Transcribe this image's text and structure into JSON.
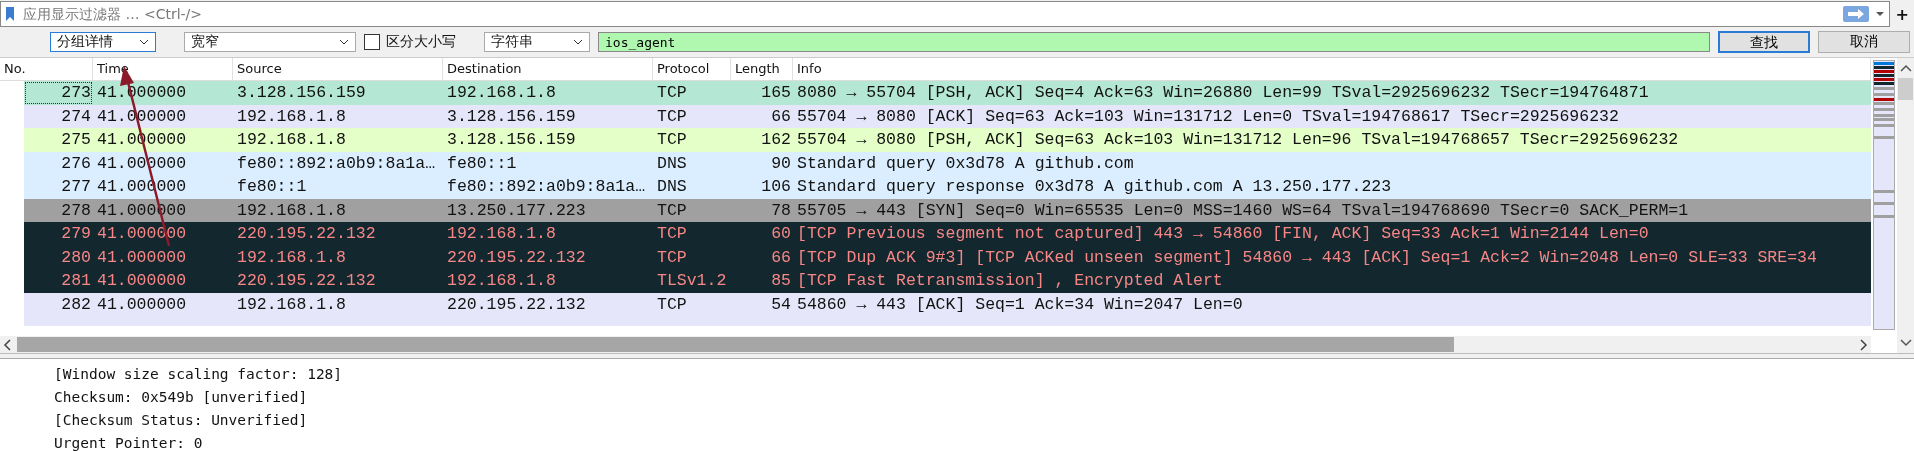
{
  "filter_bar": {
    "placeholder": "应用显示过滤器 … <Ctrl-/>",
    "add_label": "+"
  },
  "find_bar": {
    "search_in": "分组详情",
    "charset": "宽窄",
    "case_sensitive": {
      "label": "区分大小写",
      "checked": false
    },
    "search_type": "字符串",
    "value": "ios_agent",
    "buttons": [
      "查找",
      "取消"
    ]
  },
  "table": {
    "columns": [
      "No.",
      "Time",
      "Source",
      "Destination",
      "Protocol",
      "Length",
      "Info"
    ],
    "rows": [
      {
        "cells": [
          "273",
          "41.000000",
          "3.128.156.159",
          "192.168.1.8",
          "TCP",
          "165",
          "8080 → 55704 [PSH, ACK] Seq=4 Ack=63 Win=26880 Len=99 TSval=2925696232 TSecr=194764871"
        ],
        "color": "#b5e8d4",
        "kind": "normal",
        "focused": true
      },
      {
        "cells": [
          "274",
          "41.000000",
          "192.168.1.8",
          "3.128.156.159",
          "TCP",
          "66",
          "55704 → 8080 [ACK] Seq=63 Ack=103 Win=131712 Len=0 TSval=194768617 TSecr=2925696232"
        ],
        "color": "#e6e6fa",
        "kind": "normal",
        "focused": false
      },
      {
        "cells": [
          "275",
          "41.000000",
          "192.168.1.8",
          "3.128.156.159",
          "TCP",
          "162",
          "55704 → 8080 [PSH, ACK] Seq=63 Ack=103 Win=131712 Len=96 TSval=194768657 TSecr=2925696232"
        ],
        "color": "#e4ffc7",
        "kind": "normal",
        "focused": false
      },
      {
        "cells": [
          "276",
          "41.000000",
          "fe80::892:a0b9:8a1a…",
          "fe80::1",
          "DNS",
          "90",
          "Standard query 0x3d78 A github.com"
        ],
        "color": "#daeeff",
        "kind": "normal",
        "focused": false
      },
      {
        "cells": [
          "277",
          "41.000000",
          "fe80::1",
          "fe80::892:a0b9:8a1a…",
          "DNS",
          "106",
          "Standard query response 0x3d78 A github.com A 13.250.177.223"
        ],
        "color": "#daeeff",
        "kind": "normal",
        "focused": false
      },
      {
        "cells": [
          "278",
          "41.000000",
          "192.168.1.8",
          "13.250.177.223",
          "TCP",
          "78",
          "55705 → 443 [SYN] Seq=0 Win=65535 Len=0 MSS=1460 WS=64 TSval=194768690 TSecr=0 SACK_PERM=1"
        ],
        "color": "#a0a0a0",
        "kind": "normal",
        "focused": false
      },
      {
        "cells": [
          "279",
          "41.000000",
          "220.195.22.132",
          "192.168.1.8",
          "TCP",
          "60",
          "[TCP Previous segment not captured] 443 → 54860 [FIN, ACK] Seq=33 Ack=1 Win=2144 Len=0"
        ],
        "color": "#12272e",
        "kind": "alert",
        "focused": false
      },
      {
        "cells": [
          "280",
          "41.000000",
          "192.168.1.8",
          "220.195.22.132",
          "TCP",
          "66",
          "[TCP Dup ACK 9#3] [TCP ACKed unseen segment] 54860 → 443 [ACK] Seq=1 Ack=2 Win=2048 Len=0 SLE=33 SRE=34"
        ],
        "color": "#12272e",
        "kind": "alert",
        "focused": false
      },
      {
        "cells": [
          "281",
          "41.000000",
          "220.195.22.132",
          "192.168.1.8",
          "TLSv1.2",
          "85",
          "[TCP Fast Retransmission] , Encrypted Alert"
        ],
        "color": "#12272e",
        "kind": "alert",
        "focused": false
      },
      {
        "cells": [
          "282",
          "41.000000",
          "192.168.1.8",
          "220.195.22.132",
          "TCP",
          "54",
          "54860 → 443 [ACK] Seq=1 Ack=34 Win=2047 Len=0"
        ],
        "color": "#e6e6fa",
        "kind": "normal",
        "focused": false
      }
    ]
  },
  "details": [
    "[Window size scaling factor: 128]",
    "Checksum: 0x549b [unverified]",
    "[Checksum Status: Unverified]",
    "Urgent Pointer: 0"
  ]
}
